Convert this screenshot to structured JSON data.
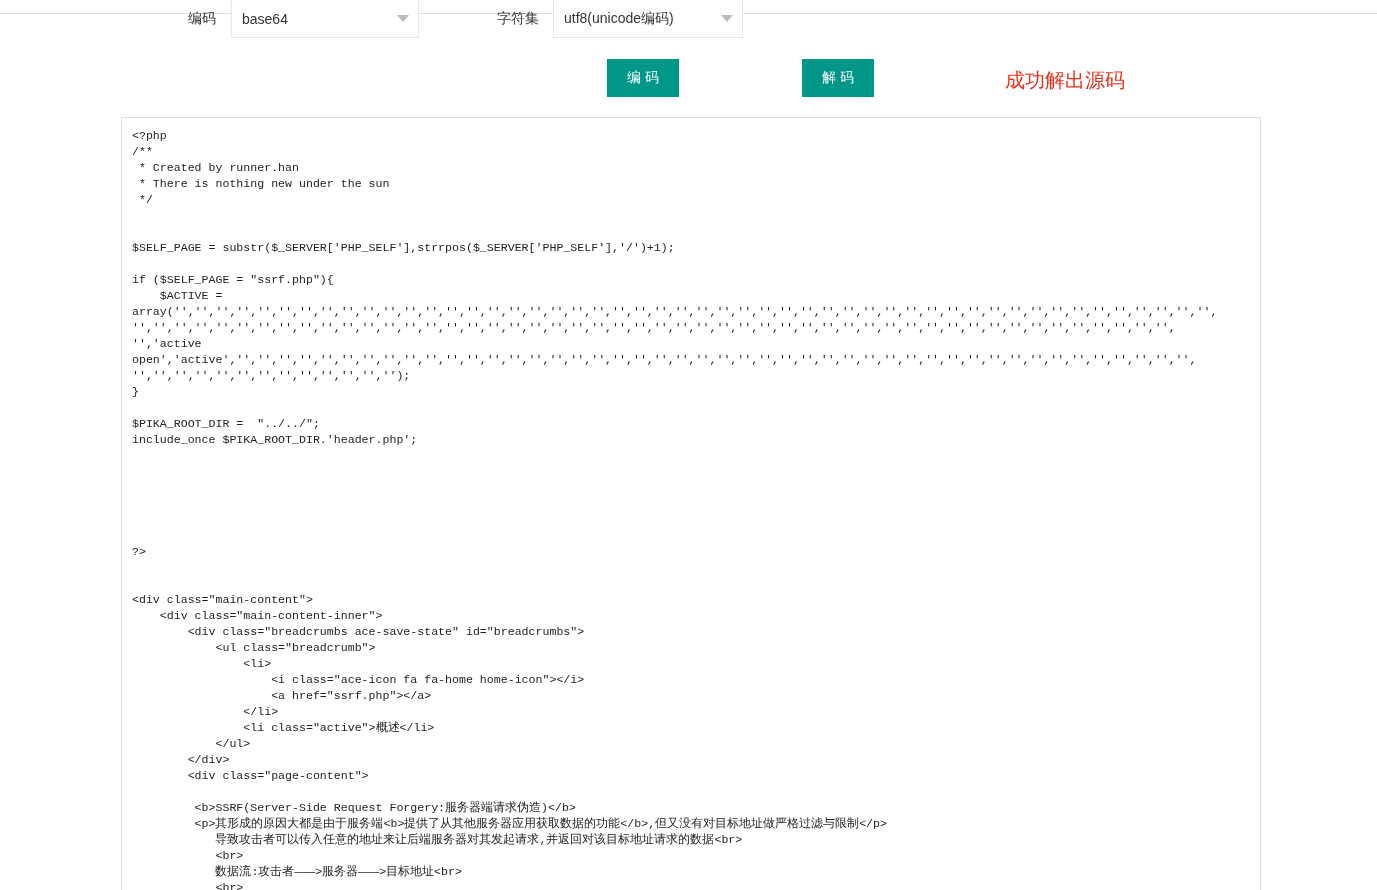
{
  "form": {
    "fields": [
      {
        "label": "编码",
        "value": "base64"
      },
      {
        "label": "字符集",
        "value": "utf8(unicode编码)"
      }
    ],
    "buttons": [
      "编 码",
      "解 码"
    ],
    "status": "成功解出源码"
  },
  "code": "<?php\n/**\n * Created by runner.han\n * There is nothing new under the sun\n */\n\n\n$SELF_PAGE = substr($_SERVER['PHP_SELF'],strrpos($_SERVER['PHP_SELF'],'/')+1);\n\nif ($SELF_PAGE = \"ssrf.php\"){\n    $ACTIVE =\narray('','','','','','','','','','','','','','','','','','','','','','','','','','','','','','','','','','','','','','','','','','','','','','','','','','',\n'','','','','','','','','','','','','','','','','','','','','','','','','','','','','','','','','','','','','','','','','','','','','','','','','','',\n'','active\nopen','active','','','','','','','','','','','','','','','','','','','','','','','','','','','','','','','','','','','','','','','','','','','','','','',\n'','','','','','','','','','','','','');\n}\n\n$PIKA_ROOT_DIR =  \"../../\";\ninclude_once $PIKA_ROOT_DIR.'header.php';\n\n\n\n\n\n\n?>\n\n\n<div class=\"main-content\">\n    <div class=\"main-content-inner\">\n        <div class=\"breadcrumbs ace-save-state\" id=\"breadcrumbs\">\n            <ul class=\"breadcrumb\">\n                <li>\n                    <i class=\"ace-icon fa fa-home home-icon\"></i>\n                    <a href=\"ssrf.php\"></a>\n                </li>\n                <li class=\"active\">概述</li>\n            </ul>\n        </div>\n        <div class=\"page-content\">\n\n         <b>SSRF(Server-Side Request Forgery:服务器端请求伪造)</b>\n         <p>其形成的原因大都是由于服务端<b>提供了从其他服务器应用获取数据的功能</b>,但又没有对目标地址做严格过滤与限制</p>\n            导致攻击者可以传入任意的地址来让后端服务器对其发起请求,并返回对该目标地址请求的数据<br>\n            <br>\n            数据流:攻击者———>服务器———>目标地址<br>\n            <br>"
}
